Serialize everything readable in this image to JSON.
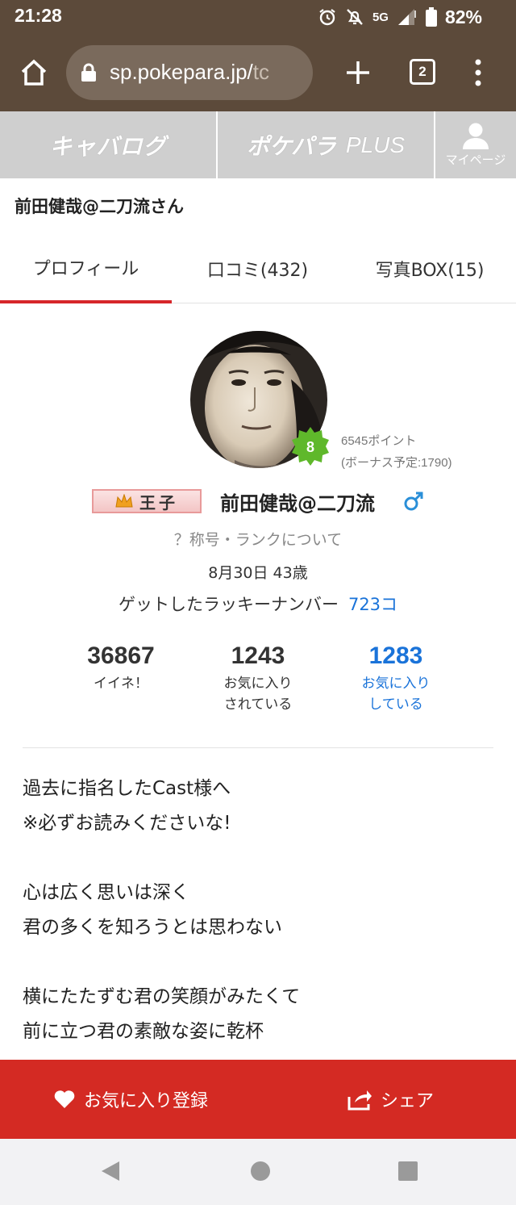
{
  "status_bar": {
    "time": "21:28",
    "network": "5G",
    "battery": "82%",
    "icons": [
      "alarm-icon",
      "muted-bell-icon",
      "signal-icon",
      "battery-icon"
    ]
  },
  "browser": {
    "url_main": "sp.pokepara.jp/",
    "url_faded": "tc",
    "tab_count": "2",
    "icons": [
      "home-icon",
      "lock-icon",
      "plus-icon",
      "tabs-icon",
      "more-vert-icon"
    ]
  },
  "site_nav": {
    "logo_left": "キャバログ",
    "logo_mid_brand": "ポケパラ",
    "logo_mid_plus": "PLUS",
    "mypage_label": "マイページ"
  },
  "page_title": "前田健哉@二刀流さん",
  "tabs": [
    {
      "label": "プロフィール",
      "active": true
    },
    {
      "label": "口コミ(432)",
      "active": false
    },
    {
      "label": "写真BOX(15)",
      "active": false
    }
  ],
  "profile": {
    "rank_level": "8",
    "points": "6545ポイント",
    "bonus": "(ボーナス予定:1790)",
    "title_badge": "王子",
    "name": "前田健哉@二刀流",
    "gender_icon": "male-icon",
    "rank_help": "？称号・ランクについて",
    "birthday_age": "8月30日 43歳",
    "lucky_label": "ゲットしたラッキーナンバー",
    "lucky_value": "723コ"
  },
  "stats": [
    {
      "value": "36867",
      "label_line1": "イイネ！",
      "label_line2": ""
    },
    {
      "value": "1243",
      "label_line1": "お気に入り",
      "label_line2": "されている"
    },
    {
      "value": "1283",
      "label_line1": "お気に入り",
      "label_line2": "している"
    }
  ],
  "bio": {
    "p1_line1": "過去に指名したCast様へ",
    "p1_line2": "※必ずお読みくださいな!",
    "p2_line1": "心は広く思いは深く",
    "p2_line2": "君の多くを知ろうとは思わない",
    "p3_line1": "横にたたずむ君の笑顔がみたくて",
    "p3_line2": "前に立つ君の素敵な姿に乾杯"
  },
  "actions": {
    "favorite_label": "お気に入り登録",
    "share_label": "シェア"
  },
  "colors": {
    "status_bg": "#5c4a3a",
    "accent_red": "#d42a23",
    "tab_active": "#d6262a",
    "link_blue": "#1a73d9",
    "nav_gray": "#cfcfcf"
  }
}
